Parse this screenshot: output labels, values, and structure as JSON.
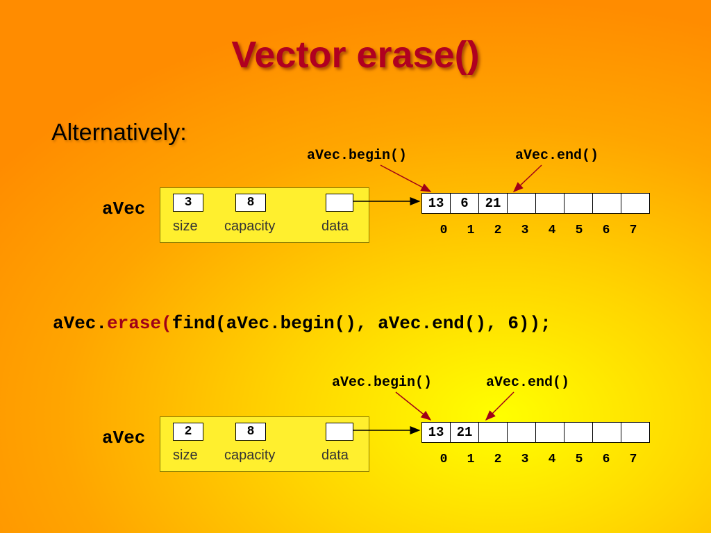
{
  "title": "Vector erase()",
  "subhead": "Alternatively:",
  "code_line": {
    "pre": "aVec.",
    "erase": "erase(",
    "post": "find(aVec.begin(), aVec.end(), 6));"
  },
  "chart_data": {
    "type": "table",
    "vectors": [
      {
        "name": "aVec",
        "size": 3,
        "capacity": 8,
        "data": [
          "13",
          "6",
          "21",
          "",
          "",
          "",
          "",
          ""
        ],
        "indices": [
          "0",
          "1",
          "2",
          "3",
          "4",
          "5",
          "6",
          "7"
        ],
        "begin_label": "aVec.begin()",
        "begin_index": 0,
        "end_label": "aVec.end()",
        "end_index": 3,
        "field_labels": {
          "size": "size",
          "capacity": "capacity",
          "data": "data"
        }
      },
      {
        "name": "aVec",
        "size": 2,
        "capacity": 8,
        "data": [
          "13",
          "21",
          "",
          "",
          "",
          "",
          "",
          ""
        ],
        "indices": [
          "0",
          "1",
          "2",
          "3",
          "4",
          "5",
          "6",
          "7"
        ],
        "begin_label": "aVec.begin()",
        "begin_index": 0,
        "end_label": "aVec.end()",
        "end_index": 2,
        "field_labels": {
          "size": "size",
          "capacity": "capacity",
          "data": "data"
        }
      }
    ]
  }
}
